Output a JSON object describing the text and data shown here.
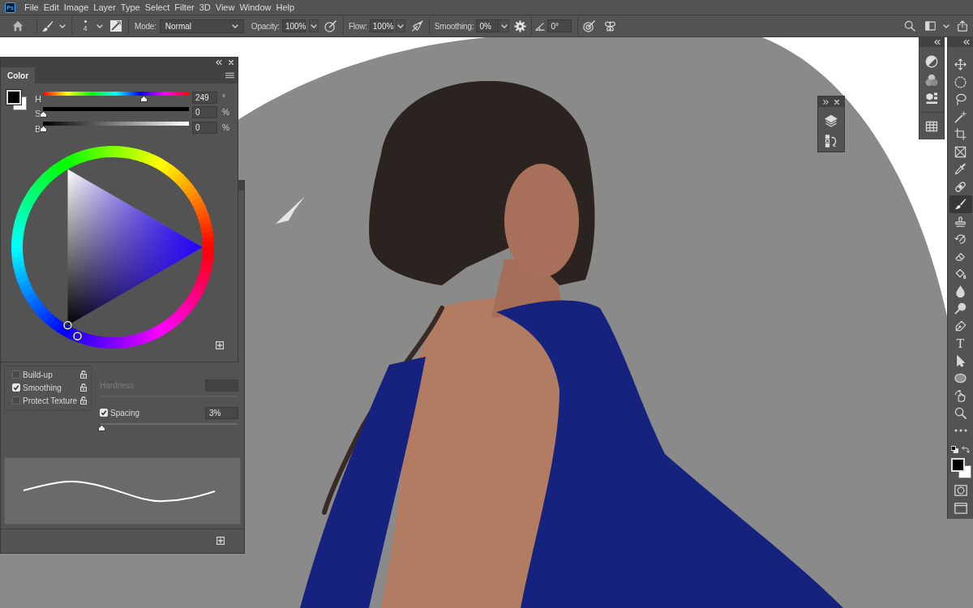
{
  "menu_bar": {
    "logo": "Ps",
    "items": [
      "File",
      "Edit",
      "Image",
      "Layer",
      "Type",
      "Select",
      "Filter",
      "3D",
      "View",
      "Window",
      "Help"
    ]
  },
  "options_bar": {
    "brush_size": "4",
    "mode_label": "Mode:",
    "mode": "Normal",
    "opacity_label": "Opacity:",
    "opacity": "100%",
    "flow_label": "Flow:",
    "flow": "100%",
    "smoothing_label": "Smoothing:",
    "smoothing": "0%",
    "angle": "0°"
  },
  "color_panel": {
    "tabs": [
      {
        "label": "Color",
        "selected": true
      }
    ],
    "sliders": [
      {
        "label": "H",
        "level": 0.69,
        "value": "249",
        "unit": "°"
      },
      {
        "label": "S",
        "level": 0,
        "value": "0",
        "unit": "%"
      },
      {
        "label": "B",
        "level": 0,
        "value": "0",
        "unit": "%"
      }
    ]
  },
  "brush_settings": {
    "options": [
      {
        "label": "Build-up",
        "checked": false
      },
      {
        "label": "Smoothing",
        "checked": true
      },
      {
        "label": "Protect Texture",
        "checked": false
      }
    ],
    "hardness": {
      "label": "Hardness",
      "disabled": true
    },
    "spacing": {
      "label": "Spacing",
      "checked": true,
      "value": "3%",
      "level": 0.01
    }
  },
  "toolbar": {
    "tools": [
      {
        "kind": "move",
        "selected": false
      },
      {
        "kind": "marquee",
        "selected": false
      },
      {
        "kind": "lasso",
        "selected": false
      },
      {
        "kind": "wand",
        "selected": false
      },
      {
        "kind": "crop",
        "selected": false
      },
      {
        "kind": "frame",
        "selected": false
      },
      {
        "kind": "eyedropper",
        "selected": false
      },
      {
        "kind": "healing",
        "selected": false
      },
      {
        "kind": "brush",
        "selected": true
      },
      {
        "kind": "stamp",
        "selected": false
      },
      {
        "kind": "history",
        "selected": false
      },
      {
        "kind": "eraser",
        "selected": false
      },
      {
        "kind": "bucket",
        "selected": false
      },
      {
        "kind": "blur",
        "selected": false
      },
      {
        "kind": "dodge",
        "selected": false
      },
      {
        "kind": "pen",
        "selected": false
      },
      {
        "kind": "type",
        "glyph": "T",
        "selected": false
      },
      {
        "kind": "select",
        "selected": false
      },
      {
        "kind": "shape",
        "selected": false
      },
      {
        "kind": "rotate",
        "selected": false
      },
      {
        "kind": "zoom",
        "selected": false
      },
      {
        "kind": "more",
        "selected": false
      }
    ]
  }
}
